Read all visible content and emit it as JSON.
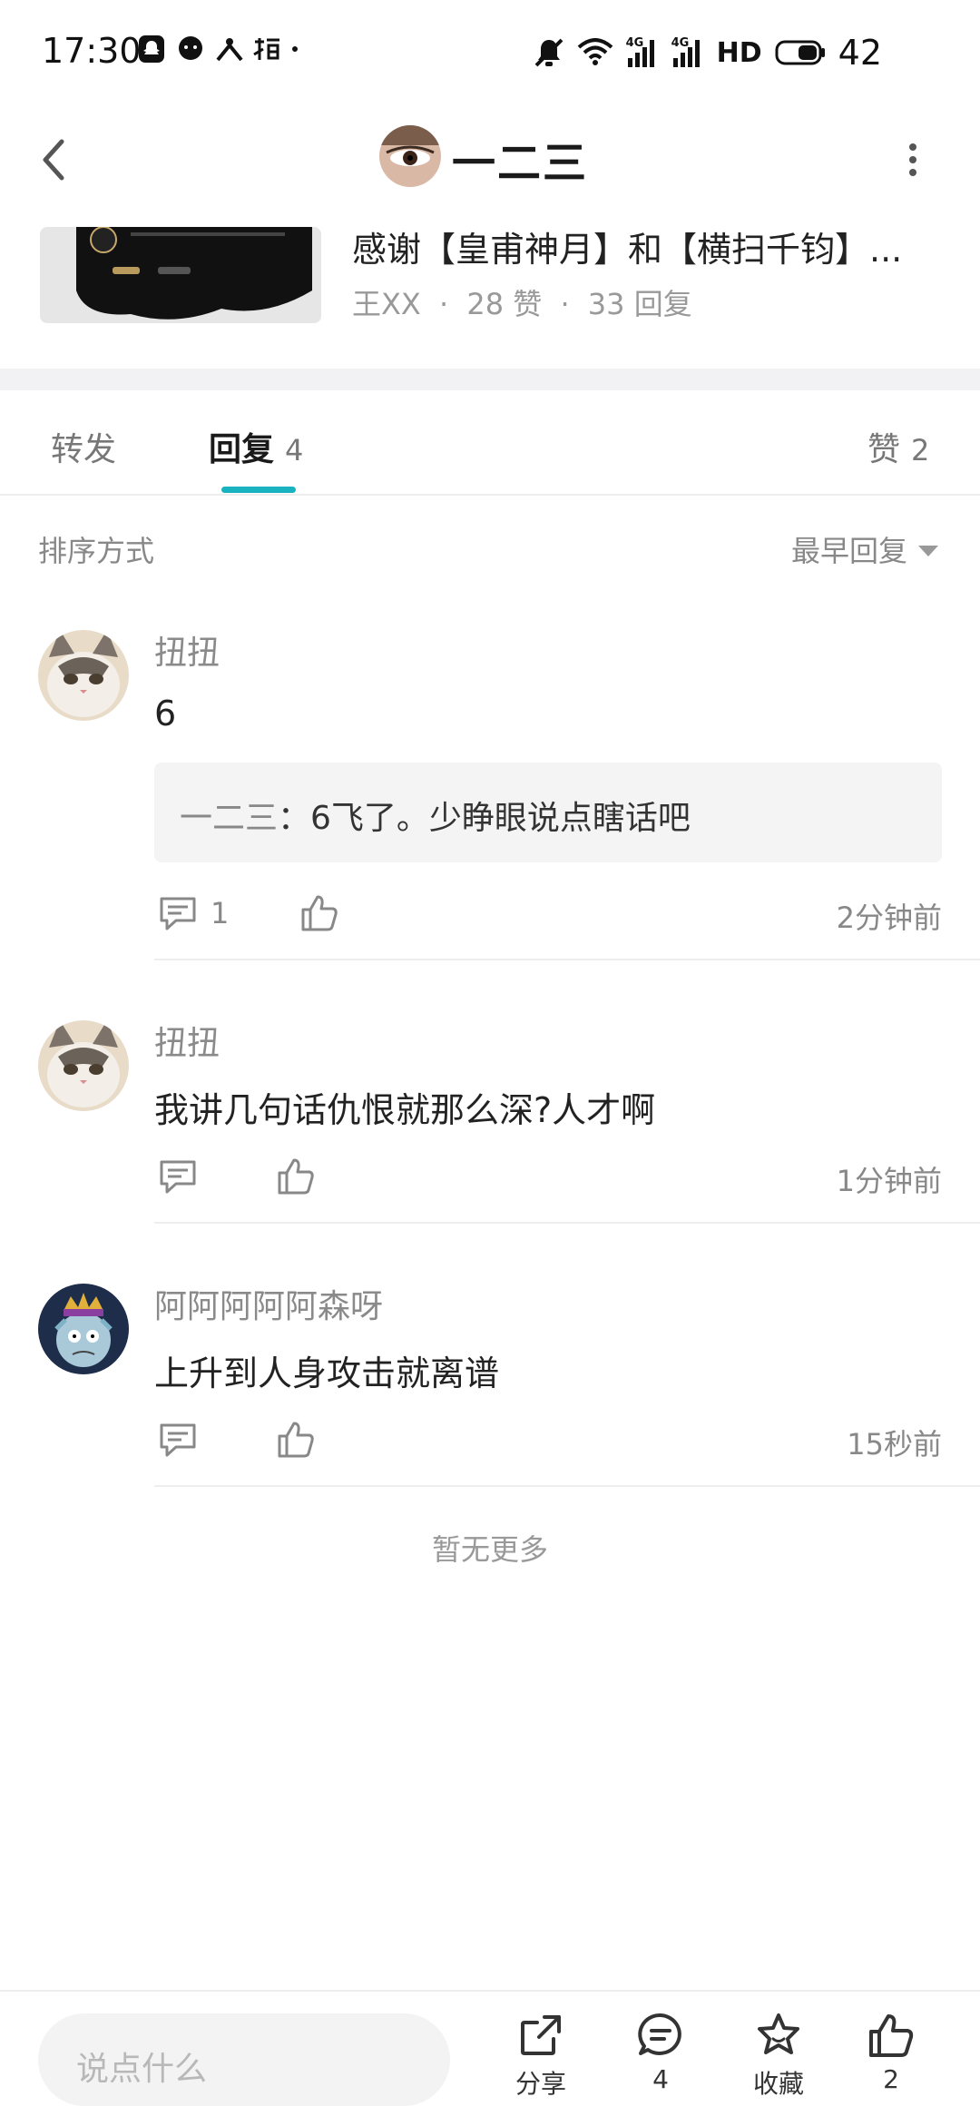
{
  "status_bar": {
    "time": "17:30",
    "battery": "42",
    "network_labels": [
      "4G",
      "4G",
      "HD"
    ]
  },
  "header": {
    "title": "一二三",
    "back_icon": "chevron-left-icon",
    "more_icon": "more-vertical-icon"
  },
  "post": {
    "title": "感谢【皇甫神月】和【横扫千钧】...",
    "author": "王XX",
    "likes": "28 赞",
    "replies": "33 回复",
    "separator": "·"
  },
  "tabs": [
    {
      "label": "转发",
      "count": ""
    },
    {
      "label": "回复",
      "count": "4"
    },
    {
      "label": "赞",
      "count": "2"
    }
  ],
  "sort": {
    "label": "排序方式",
    "value": "最早回复"
  },
  "comments": [
    {
      "name": "扭扭",
      "text": "6",
      "quote_name": "一二三",
      "quote_sep": "：",
      "quote_text": "6飞了。少睁眼说点瞎话吧",
      "reply_count": "1",
      "time": "2分钟前"
    },
    {
      "name": "扭扭",
      "text": "我讲几句话仇恨就那么深?人才啊",
      "reply_count": "",
      "time": "1分钟前"
    },
    {
      "name": "阿阿阿阿阿森呀",
      "text": "上升到人身攻击就离谱",
      "reply_count": "",
      "time": "15秒前"
    }
  ],
  "no_more": "暂无更多",
  "bottom_bar": {
    "input_placeholder": "说点什么",
    "share_label": "分享",
    "comment_count": "4",
    "favorite_label": "收藏",
    "like_count": "2"
  },
  "colors": {
    "accent": "#19b2c1",
    "muted_text": "#888888",
    "divider": "#eeeeee"
  }
}
